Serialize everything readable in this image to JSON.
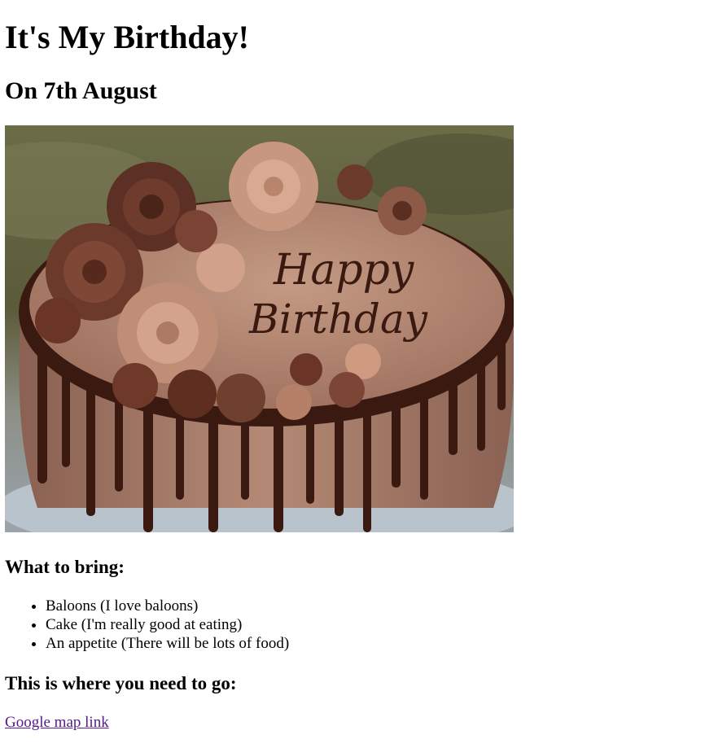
{
  "title": "It's My Birthday!",
  "subtitle": "On 7th August",
  "image": {
    "icon": "birthday-cake-photo",
    "cake_text_line1": "Happy",
    "cake_text_line2": "Birthday"
  },
  "bring": {
    "heading": "What to bring:",
    "items": [
      "Baloons (I love baloons)",
      "Cake (I'm really good at eating)",
      "An appetite (There will be lots of food)"
    ]
  },
  "location": {
    "heading": "This is where you need to go:",
    "link_text": "Google map link"
  },
  "colors": {
    "link_visited": "#551a8b",
    "cake_frosting": "#b08671",
    "chocolate_drip": "#3a1a10"
  }
}
